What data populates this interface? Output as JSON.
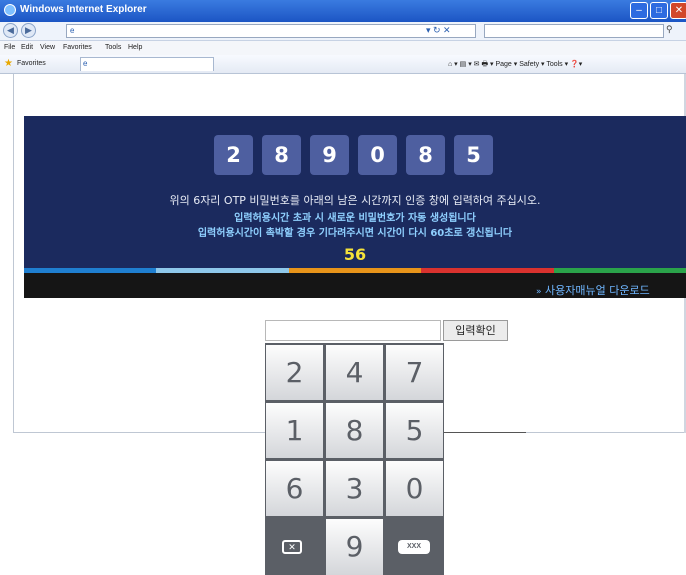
{
  "window": {
    "title": "Windows Internet Explorer",
    "menu": [
      "File",
      "Edit",
      "View",
      "Favorites",
      "Tools",
      "Help"
    ],
    "favorites_label": "Favorites",
    "command_bar": "⌂ ▾  ▤ ▾  ✉  🖶 ▾  Page ▾  Safety ▾  Tools ▾  ❓▾"
  },
  "otp": {
    "digits": [
      "2",
      "8",
      "9",
      "0",
      "8",
      "5"
    ],
    "message_1": "위의 6자리 OTP 비밀번호를 아래의 남은 시간까지 인증 창에 입력하여 주십시오.",
    "message_2": "입력허용시간 초과 시 새로운 비밀번호가 자동 생성됩니다",
    "message_3": "입력허용시간이 촉박할 경우 기다려주시면 시간이 다시 60초로 갱신됩니다",
    "countdown": "56",
    "manual_link": "사용자매뉴얼 다운로드",
    "stripe_colors": [
      "#1f7fd0",
      "#8fc8ea",
      "#e8941a",
      "#d9322e",
      "#2aa34a"
    ]
  },
  "input": {
    "value": "",
    "confirm_label": "입력확인"
  },
  "keypad": {
    "keys": [
      "2",
      "4",
      "7",
      "1",
      "8",
      "5",
      "6",
      "3",
      "0",
      "9"
    ],
    "backspace_icon": "backspace-icon",
    "clear_label": "XXX"
  },
  "colors": {
    "banner_bg": "#1b2a5e",
    "digit_box": "#4e5fa0",
    "countdown": "#f5e23a",
    "keypad_dark": "#5b5f66"
  }
}
